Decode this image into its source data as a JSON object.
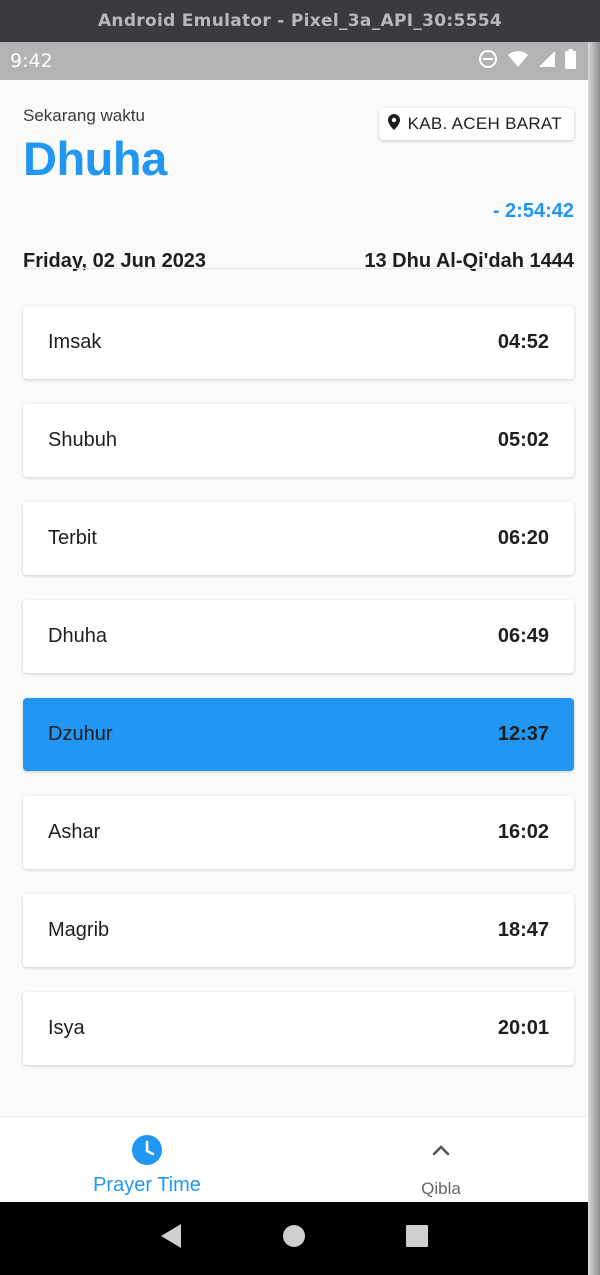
{
  "window": {
    "title": "Android Emulator - Pixel_3a_API_30:5554"
  },
  "status_bar": {
    "time": "9:42",
    "icons": [
      "do-not-disturb-icon",
      "wifi-icon",
      "cellular-signal-icon",
      "battery-icon"
    ]
  },
  "header": {
    "now_label": "Sekarang waktu",
    "current_prayer": "Dhuha",
    "location": "KAB. ACEH BARAT",
    "countdown": "- 2:54:42",
    "gregorian_date": "Friday, 02 Jun 2023",
    "hijri_date": "13 Dhu Al-Qi'dah 1444"
  },
  "prayers": [
    {
      "name": "Imsak",
      "time": "04:52"
    },
    {
      "name": "Shubuh",
      "time": "05:02"
    },
    {
      "name": "Terbit",
      "time": "06:20"
    },
    {
      "name": "Dhuha",
      "time": "06:49"
    },
    {
      "name": "Dzuhur",
      "time": "12:37",
      "highlighted": true
    },
    {
      "name": "Ashar",
      "time": "16:02"
    },
    {
      "name": "Magrib",
      "time": "18:47"
    },
    {
      "name": "Isya",
      "time": "20:01"
    }
  ],
  "bottom_nav": {
    "items": [
      {
        "label": "Prayer Time",
        "icon": "clock-icon",
        "active": true
      },
      {
        "label": "Qibla",
        "icon": "chevron-up-icon",
        "active": false
      }
    ]
  },
  "colors": {
    "accent": "#2196f3",
    "background": "#fafafa",
    "card": "#ffffff"
  }
}
